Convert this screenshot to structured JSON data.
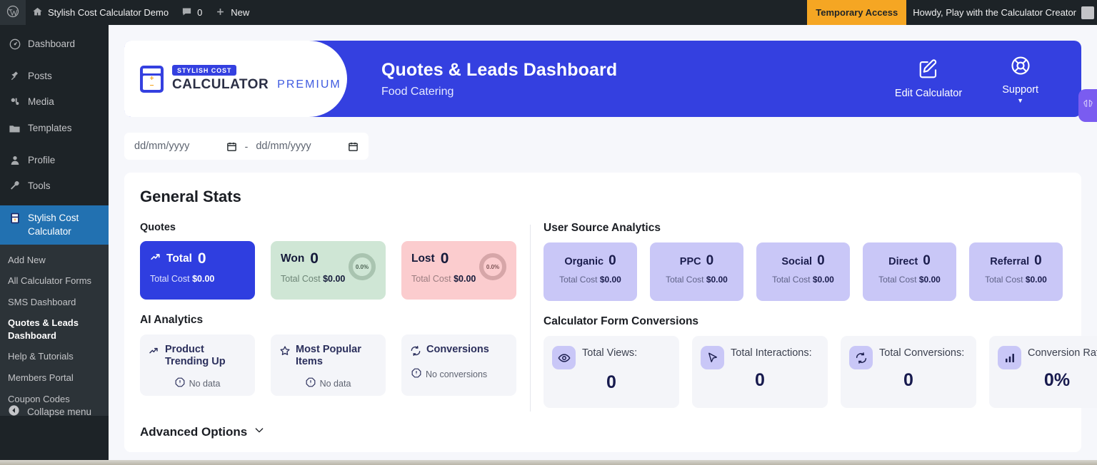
{
  "adminbar": {
    "site_name": "Stylish Cost Calculator Demo",
    "comment_count": "0",
    "new_label": "New",
    "temporary_access": "Temporary Access",
    "howdy": "Howdy, Play with the Calculator Creator"
  },
  "sidebar": {
    "items": [
      {
        "label": "Dashboard",
        "icon": "dashboard-icon"
      },
      {
        "label": "Posts",
        "icon": "pin-icon"
      },
      {
        "label": "Media",
        "icon": "media-icon"
      },
      {
        "label": "Templates",
        "icon": "folder-icon"
      },
      {
        "label": "Profile",
        "icon": "user-icon"
      },
      {
        "label": "Tools",
        "icon": "wrench-icon"
      },
      {
        "label": "Stylish Cost Calculator",
        "icon": "calculator-icon"
      }
    ],
    "submenu": [
      "Add New",
      "All Calculator Forms",
      "SMS Dashboard",
      "Quotes & Leads Dashboard",
      "Help & Tutorials",
      "Members Portal",
      "Coupon Codes"
    ],
    "collapse_label": "Collapse menu"
  },
  "banner": {
    "logo_badge": "STYLISH COST",
    "logo_name": "CALCULATOR",
    "logo_edition": "PREMIUM",
    "title": "Quotes & Leads Dashboard",
    "subtitle": "Food Catering",
    "actions": [
      {
        "label": "Edit Calculator",
        "icon": "edit-square-icon"
      },
      {
        "label": "Support",
        "icon": "lifebuoy-icon"
      }
    ],
    "brand_color": "#3440e0"
  },
  "daterange": {
    "start_placeholder": "dd/mm/yyyy",
    "end_placeholder": "dd/mm/yyyy",
    "start_value": "",
    "end_value": "",
    "separator": "-"
  },
  "stats": {
    "title": "General Stats",
    "quotes_label": "Quotes",
    "ai_label": "AI Analytics",
    "source_label": "User Source Analytics",
    "conversions_label": "Calculator Form Conversions",
    "total_cost_label": "Total Cost",
    "quotes": [
      {
        "name": "Total",
        "value": "0",
        "cost": "$0.00",
        "icon": "trending-up-icon",
        "percent": null,
        "variant": "total"
      },
      {
        "name": "Won",
        "value": "0",
        "cost": "$0.00",
        "icon": null,
        "percent": "0.0%",
        "variant": "won"
      },
      {
        "name": "Lost",
        "value": "0",
        "cost": "$0.00",
        "icon": null,
        "percent": "0.0%",
        "variant": "lost"
      }
    ],
    "ai_cards": [
      {
        "name": "Product Trending Up",
        "icon": "trending-up-icon",
        "empty": "No data"
      },
      {
        "name": "Most Popular Items",
        "icon": "star-icon",
        "empty": "No data"
      },
      {
        "name": "Conversions",
        "icon": "refresh-icon",
        "empty": "No conversions"
      }
    ],
    "sources": [
      {
        "name": "Organic",
        "value": "0",
        "cost": "$0.00"
      },
      {
        "name": "PPC",
        "value": "0",
        "cost": "$0.00"
      },
      {
        "name": "Social",
        "value": "0",
        "cost": "$0.00"
      },
      {
        "name": "Direct",
        "value": "0",
        "cost": "$0.00"
      },
      {
        "name": "Referral",
        "value": "0",
        "cost": "$0.00"
      }
    ],
    "conversions": [
      {
        "label": "Total Views:",
        "value": "0",
        "icon": "eye-icon"
      },
      {
        "label": "Total Interactions:",
        "value": "0",
        "icon": "cursor-icon"
      },
      {
        "label": "Total Conversions:",
        "value": "0",
        "icon": "refresh-icon"
      },
      {
        "label": "Conversion Rate:",
        "value": "0%",
        "icon": "bar-chart-icon"
      }
    ],
    "advanced_options": "Advanced Options"
  }
}
